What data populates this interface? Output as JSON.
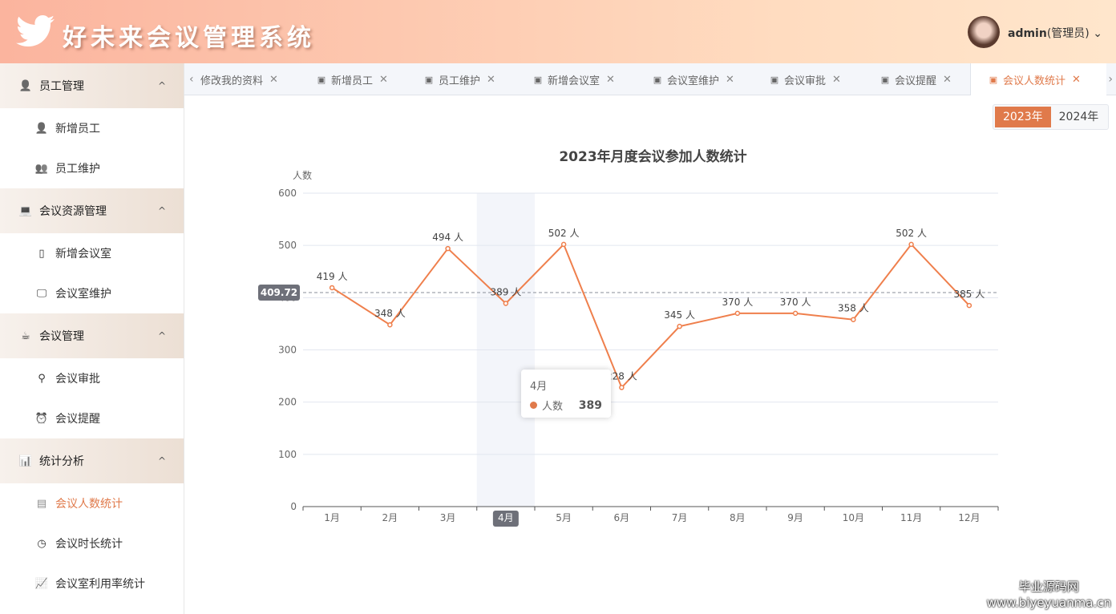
{
  "header": {
    "title": "好未来会议管理系统",
    "user": "admin",
    "role": "(管理员)"
  },
  "sidebar": [
    {
      "label": "员工管理",
      "icon": "user-icon",
      "items": [
        {
          "label": "新增员工",
          "icon": "user-add-icon"
        },
        {
          "label": "员工维护",
          "icon": "user-list-icon"
        }
      ]
    },
    {
      "label": "会议资源管理",
      "icon": "monitor-icon",
      "items": [
        {
          "label": "新增会议室",
          "icon": "room-icon"
        },
        {
          "label": "会议室维护",
          "icon": "presentation-icon"
        }
      ]
    },
    {
      "label": "会议管理",
      "icon": "coffee-icon",
      "items": [
        {
          "label": "会议审批",
          "icon": "stamp-icon"
        },
        {
          "label": "会议提醒",
          "icon": "alarm-icon"
        }
      ]
    },
    {
      "label": "统计分析",
      "icon": "bar-chart-icon",
      "items": [
        {
          "label": "会议人数统计",
          "icon": "stats-icon",
          "active": true
        },
        {
          "label": "会议时长统计",
          "icon": "time-stats-icon"
        },
        {
          "label": "会议室利用率统计",
          "icon": "line-chart-icon"
        }
      ]
    }
  ],
  "tabs": [
    "修改我的资料",
    "新增员工",
    "员工维护",
    "新增会议室",
    "会议室维护",
    "会议审批",
    "会议提醒",
    "会议人数统计"
  ],
  "years": [
    "2023年",
    "2024年"
  ],
  "tooltip": {
    "month": "4月",
    "series": "人数",
    "value": "389"
  },
  "watermark": {
    "line1": "毕业源码网",
    "line2": "www.biyeyuanma.cn"
  },
  "chart_data": {
    "type": "line",
    "title": "2023年月度会议参加人数统计",
    "ylabel": "人数",
    "ylim": [
      0,
      600
    ],
    "yticks": [
      0,
      100,
      200,
      300,
      400,
      500,
      600
    ],
    "categories": [
      "1月",
      "2月",
      "3月",
      "4月",
      "5月",
      "6月",
      "7月",
      "8月",
      "9月",
      "10月",
      "11月",
      "12月"
    ],
    "series": [
      {
        "name": "人数",
        "values": [
          419,
          348,
          494,
          389,
          502,
          228,
          345,
          370,
          370,
          358,
          502,
          385
        ],
        "color": "#ef7f4c"
      }
    ],
    "label_suffix": " 人",
    "average_line": 409.72,
    "average_label": "409.72",
    "highlighted": "4月"
  }
}
